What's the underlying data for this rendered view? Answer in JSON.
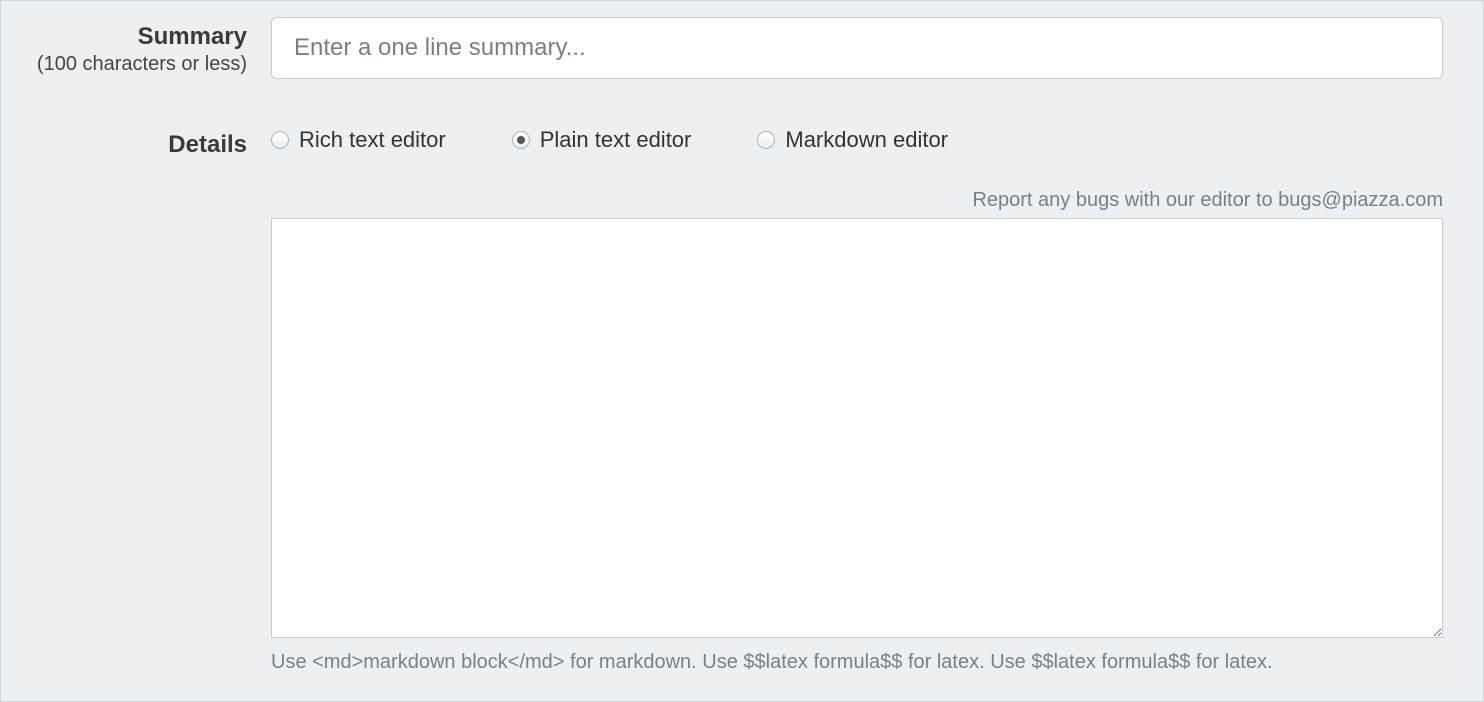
{
  "summary": {
    "label": "Summary",
    "sublabel": "(100 characters or less)",
    "placeholder": "Enter a one line summary...",
    "value": ""
  },
  "details": {
    "label": "Details",
    "editor_options": {
      "rich": "Rich text editor",
      "plain": "Plain text editor",
      "markdown": "Markdown editor"
    },
    "selected": "plain",
    "bug_note": "Report any bugs with our editor to bugs@piazza.com",
    "body_value": "",
    "hint": "Use <md>markdown block</md> for markdown. Use $$latex formula$$ for latex. Use $$latex formula$$ for latex."
  }
}
